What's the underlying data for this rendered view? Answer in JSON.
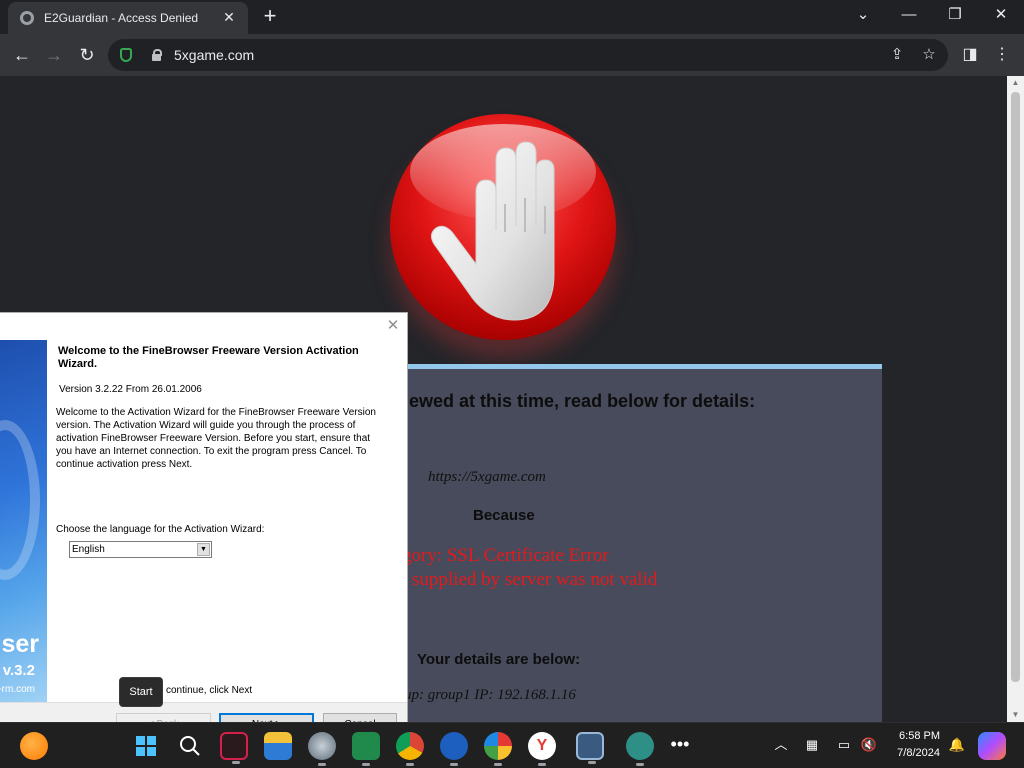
{
  "browser": {
    "tab_title": "E2Guardian - Access Denied",
    "url": "5xgame.com"
  },
  "page": {
    "heading": "iewed at this time, read below for details:",
    "url": "https://5xgame.com",
    "because": "Because",
    "category": "gory: SSL Certificate Error",
    "cert": "supplied by server was not valid",
    "details_heading": "Your details are below:",
    "group_line": "up: group1   IP: 192.168.1.16",
    "accent_color": "#e41a1a"
  },
  "wizard": {
    "title": "Welcome to the FineBrowser Freeware Version Activation Wizard.",
    "version": "Version 3.2.22 From 26.01.2006",
    "description": "Welcome to the Activation Wizard for the FineBrowser Freeware Version version. The Activation Wizard will guide you through the process of activation FineBrowser Freeware Version. Before you start, ensure that you have an Internet connection. To exit the program press Cancel. To continue activation press Next.",
    "choose_label": "Choose the language for the Activation Wizard:",
    "language_selected": "English",
    "continue_text": "continue, click Next",
    "back_label": "< Back",
    "next_label": "Next >",
    "cancel_label": "Cancel",
    "banner_brand": "ser",
    "banner_version": "v.3.2",
    "banner_site": "-rm.com"
  },
  "tooltip": {
    "text": "Start"
  },
  "taskbar": {
    "time": "6:58 PM",
    "date": "7/8/2024"
  }
}
